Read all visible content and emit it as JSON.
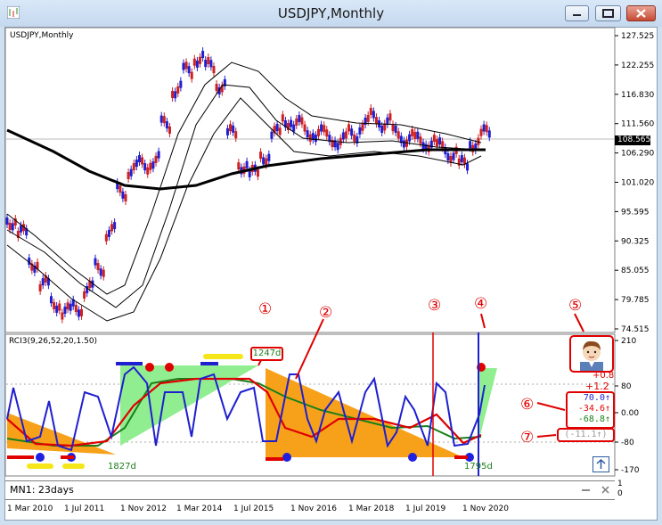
{
  "window": {
    "title": "USDJPY,Monthly",
    "buttons": [
      "minimize-button",
      "maximize-button",
      "close-button"
    ]
  },
  "main_chart": {
    "label": "USDJPY,Monthly",
    "price_ticks": [
      "127.525",
      "122.255",
      "116.830",
      "111.560",
      "106.290",
      "101.020",
      "95.595",
      "90.325",
      "85.055",
      "79.785",
      "74.515"
    ],
    "current_price": "108.565",
    "current_price_color": "#000000"
  },
  "indicator": {
    "label": "RCI3(9,26,52,20,1.50)",
    "y_ticks": [
      "210",
      "80",
      "0.00",
      "-80",
      "-170"
    ],
    "days_box": "1247d",
    "days_left": "1827d",
    "days_right": "1795d",
    "short_color": "#1f1fd0",
    "mid_color": "#e00000",
    "long_color": "#1a7f1a",
    "readout": {
      "top_a": "+0.8",
      "top_b": "+1.2",
      "row1": "70.0↑",
      "row2": "-34.6↑",
      "row3": "-68.8↑",
      "row4": "(-11.1↑)"
    }
  },
  "annotations": [
    "①",
    "②",
    "③",
    "④",
    "⑤",
    "⑥",
    "⑦"
  ],
  "sub_panel": {
    "label": "MN1: 23days",
    "y_ticks": [
      "1",
      "0"
    ]
  },
  "x_axis": {
    "labels": [
      "1 Mar 2010",
      "1 Jul 2011",
      "1 Nov 2012",
      "1 Mar 2014",
      "1 Jul 2015",
      "1 Nov 2016",
      "1 Mar 2018",
      "1 Jul 2019",
      "1 Nov 2020"
    ]
  }
}
